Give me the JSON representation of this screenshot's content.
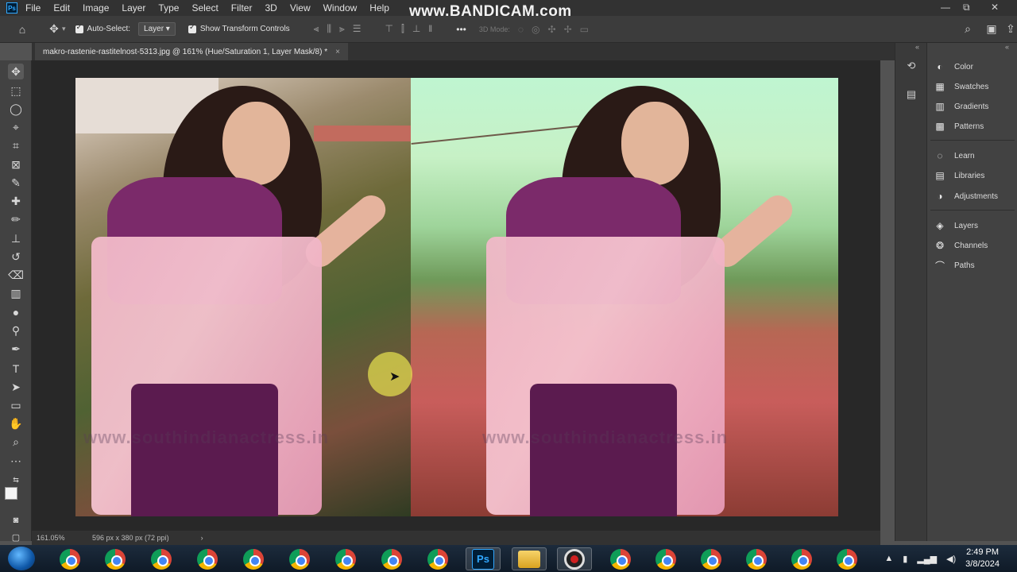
{
  "app": {
    "logo": "Ps",
    "watermark": "www.BANDICAM.com"
  },
  "menu": [
    "File",
    "Edit",
    "Image",
    "Layer",
    "Type",
    "Select",
    "Filter",
    "3D",
    "View",
    "Window",
    "Help"
  ],
  "window_controls": {
    "minimize": "—",
    "restore": "⧉",
    "close": "✕"
  },
  "options": {
    "auto_select_label": "Auto-Select:",
    "layer_select": "Layer",
    "show_transform_label": "Show Transform Controls",
    "mode_3d_label": "3D Mode:",
    "more": "•••"
  },
  "document": {
    "tab_title": "makro-rastenie-rastitelnost-5313.jpg @ 161% (Hue/Saturation 1, Layer Mask/8) *",
    "close": "×",
    "image_watermark": "www.southindianactress.in"
  },
  "status": {
    "zoom": "161.05%",
    "doc_info": "596 px x 380 px (72 ppi)",
    "arrow": "›"
  },
  "right_panel": {
    "group1": [
      "Color",
      "Swatches",
      "Gradients",
      "Patterns"
    ],
    "group2": [
      "Learn",
      "Libraries",
      "Adjustments"
    ],
    "group3": [
      "Layers",
      "Channels",
      "Paths"
    ]
  },
  "taskbar": {
    "ps_label": "Ps"
  },
  "clock": {
    "time": "2:49 PM",
    "date": "3/8/2024"
  }
}
